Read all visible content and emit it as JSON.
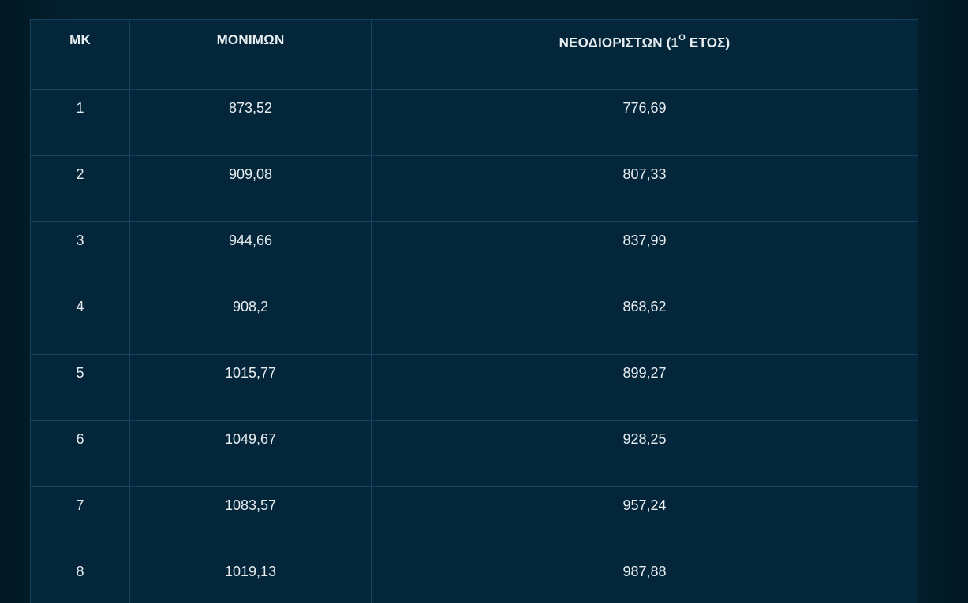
{
  "table": {
    "headers": {
      "mk": "ΜΚ",
      "permanent": "ΜΟΝΙΜΩΝ",
      "new_prefix": "ΝΕΟΔΙΟΡΙΣΤΩΝ (1",
      "new_sup": "Ο",
      "new_suffix": " ΕΤΟΣ)"
    },
    "rows": [
      {
        "mk": "1",
        "permanent": "873,52",
        "new": "776,69"
      },
      {
        "mk": "2",
        "permanent": "909,08",
        "new": "807,33"
      },
      {
        "mk": "3",
        "permanent": "944,66",
        "new": "837,99"
      },
      {
        "mk": "4",
        "permanent": "908,2",
        "new": "868,62"
      },
      {
        "mk": "5",
        "permanent": "1015,77",
        "new": "899,27"
      },
      {
        "mk": "6",
        "permanent": "1049,67",
        "new": "928,25"
      },
      {
        "mk": "7",
        "permanent": "1083,57",
        "new": "957,24"
      },
      {
        "mk": "8",
        "permanent": "1019,13",
        "new": "987,88"
      }
    ]
  }
}
